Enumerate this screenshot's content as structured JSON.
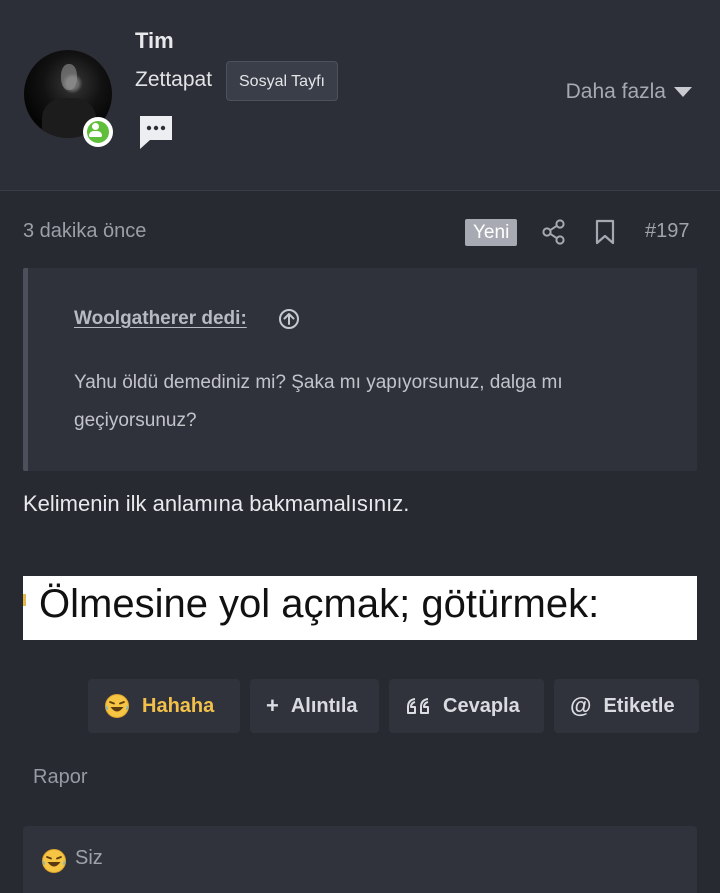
{
  "user": {
    "name": "Tim",
    "title": "Zettapat",
    "badge": "Sosyal Tayfı",
    "more_label": "Daha fazla"
  },
  "post": {
    "time": "3 dakika önce",
    "new_label": "Yeni",
    "number": "#197",
    "quote_author": "Woolgatherer dedi:",
    "quote_text": "Yahu öldü demediniz mi? Şaka mı yapıyorsunuz, dalga mı geçiyorsunuz?",
    "body": "Kelimenin ilk anlamına bakmamalısınız.",
    "image_text": "Ölmesine yol açmak; götürmek:"
  },
  "actions": {
    "laugh": "Hahaha",
    "quote": "Alıntıla",
    "reply": "Cevapla",
    "tag": "Etiketle",
    "report": "Rapor"
  },
  "reactions": {
    "who": "Siz"
  },
  "colors": {
    "background": "#282a31",
    "header": "#2c2f37",
    "laugh_accent": "#f3c04a",
    "online": "#5fbf3a"
  }
}
